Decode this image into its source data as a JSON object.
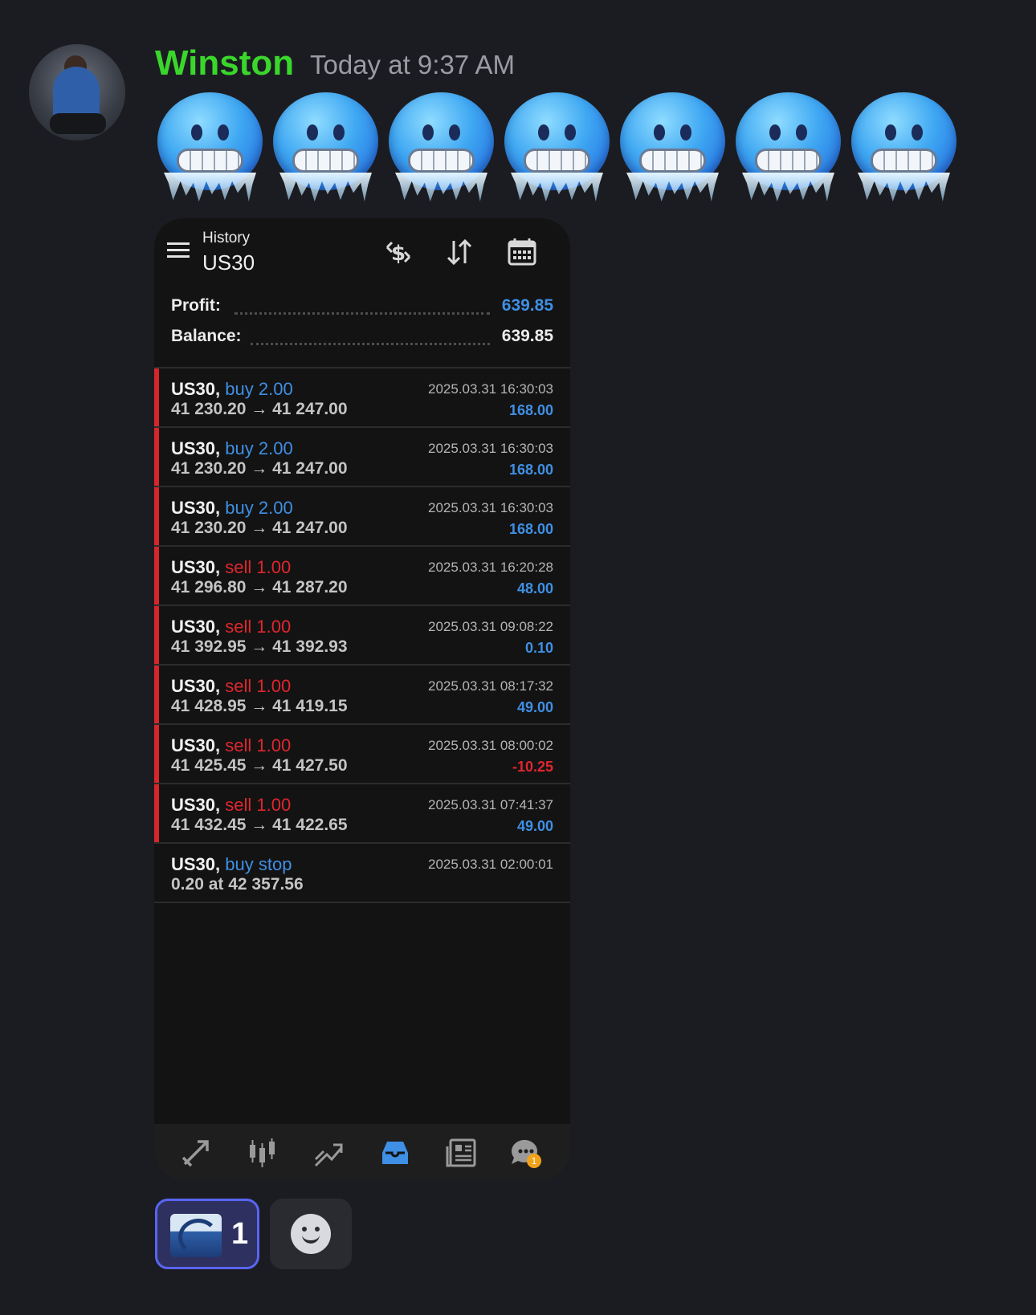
{
  "message": {
    "username": "Winston",
    "timestamp": "Today at 9:37 AM",
    "emoji_count": 7,
    "emoji_name": "cold-face"
  },
  "app": {
    "screen_label": "History",
    "symbol": "US30",
    "summary": [
      {
        "label": "Profit:",
        "value": "639.85",
        "color": "#3f8fe4"
      },
      {
        "label": "Balance:",
        "value": "639.85",
        "color": "#ececec"
      }
    ],
    "deals": [
      {
        "symbol": "US30,",
        "side": "buy 2.00",
        "type": "buy",
        "prices": "41 230.20 → 41 247.00",
        "time": "2025.03.31 16:30:03",
        "pl": "168.00",
        "pl_sign": "pos"
      },
      {
        "symbol": "US30,",
        "side": "buy 2.00",
        "type": "buy",
        "prices": "41 230.20 → 41 247.00",
        "time": "2025.03.31 16:30:03",
        "pl": "168.00",
        "pl_sign": "pos"
      },
      {
        "symbol": "US30,",
        "side": "buy 2.00",
        "type": "buy",
        "prices": "41 230.20 → 41 247.00",
        "time": "2025.03.31 16:30:03",
        "pl": "168.00",
        "pl_sign": "pos"
      },
      {
        "symbol": "US30,",
        "side": "sell 1.00",
        "type": "sell",
        "prices": "41 296.80 → 41 287.20",
        "time": "2025.03.31 16:20:28",
        "pl": "48.00",
        "pl_sign": "pos"
      },
      {
        "symbol": "US30,",
        "side": "sell 1.00",
        "type": "sell",
        "prices": "41 392.95 → 41 392.93",
        "time": "2025.03.31 09:08:22",
        "pl": "0.10",
        "pl_sign": "pos"
      },
      {
        "symbol": "US30,",
        "side": "sell 1.00",
        "type": "sell",
        "prices": "41 428.95 → 41 419.15",
        "time": "2025.03.31 08:17:32",
        "pl": "49.00",
        "pl_sign": "pos"
      },
      {
        "symbol": "US30,",
        "side": "sell 1.00",
        "type": "sell",
        "prices": "41 425.45 → 41 427.50",
        "time": "2025.03.31 08:00:02",
        "pl": "-10.25",
        "pl_sign": "neg"
      },
      {
        "symbol": "US30,",
        "side": "sell 1.00",
        "type": "sell",
        "prices": "41 432.45 → 41 422.65",
        "time": "2025.03.31 07:41:37",
        "pl": "49.00",
        "pl_sign": "pos"
      }
    ],
    "order": {
      "symbol": "US30,",
      "side": "buy stop",
      "type": "buy",
      "prices": "0.20 at 42 357.56",
      "time": "2025.03.31 02:00:01"
    },
    "toolbar_icons": [
      "dollar-swap-icon",
      "sort-icon",
      "calendar-icon"
    ],
    "nav_icons": [
      "trade-icon",
      "candles-icon",
      "chart-icon",
      "history-icon",
      "news-icon",
      "chat-icon"
    ],
    "chat_badge": "1"
  },
  "reactions": {
    "wave": {
      "emoji_name": "water-wave",
      "count": "1"
    },
    "add_label": "add-reaction"
  },
  "colors": {
    "username": "#3ad62c",
    "accent_blue": "#3f8fe4",
    "loss_red": "#e0262d",
    "reaction_border": "#5865f2"
  }
}
